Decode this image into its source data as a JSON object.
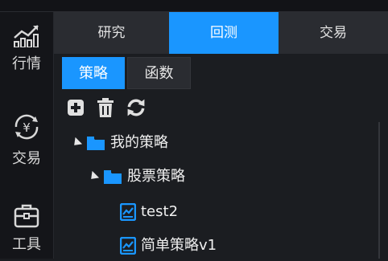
{
  "rail": {
    "items": [
      {
        "label": "行情",
        "icon": "chart-bars-icon"
      },
      {
        "label": "交易",
        "icon": "yuan-exchange-icon"
      },
      {
        "label": "工具",
        "icon": "toolbox-icon"
      }
    ]
  },
  "tabs": [
    {
      "label": "研究",
      "active": false
    },
    {
      "label": "回测",
      "active": true
    },
    {
      "label": "交易",
      "active": false
    }
  ],
  "subtabs": [
    {
      "label": "策略",
      "active": true
    },
    {
      "label": "函数",
      "active": false
    }
  ],
  "toolbar": {
    "icons": [
      "add-icon",
      "delete-icon",
      "refresh-icon"
    ]
  },
  "tree": {
    "root": "我的策略",
    "folder": "股票策略",
    "files": [
      "test2",
      "简单策略v1"
    ]
  },
  "colors": {
    "accent": "#1a96ff",
    "background": "#1b1d21",
    "tabbar": "#2a2c31"
  }
}
